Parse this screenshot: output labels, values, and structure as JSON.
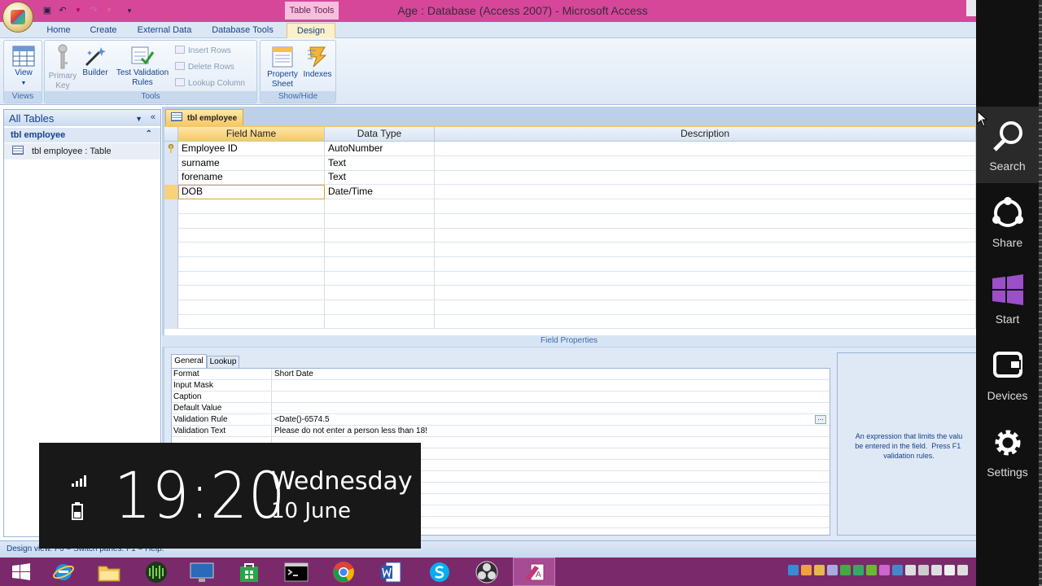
{
  "window": {
    "title": "Age : Database (Access 2007)  -  Microsoft Access",
    "context_tab": "Table Tools"
  },
  "tabs": [
    "Home",
    "Create",
    "External Data",
    "Database Tools",
    "Design"
  ],
  "ribbon": {
    "views": {
      "view": "View",
      "caption": "Views"
    },
    "tools": {
      "primary_key": "Primary Key",
      "builder": "Builder",
      "test_validation_rules": "Test Validation Rules",
      "insert_rows": "Insert Rows",
      "delete_rows": "Delete Rows",
      "lookup_column": "Lookup Column",
      "caption": "Tools"
    },
    "show_hide": {
      "property_sheet": "Property Sheet",
      "indexes": "Indexes",
      "caption": "Show/Hide"
    }
  },
  "nav_pane": {
    "header": "All Tables",
    "group": "tbl employee",
    "item": "tbl employee : Table"
  },
  "document": {
    "tab": "tbl employee",
    "columns": [
      "Field Name",
      "Data Type",
      "Description"
    ],
    "rows": [
      {
        "field": "Employee ID",
        "type": "AutoNumber",
        "primary_key": true
      },
      {
        "field": "surname",
        "type": "Text"
      },
      {
        "field": "forename",
        "type": "Text"
      },
      {
        "field": "DOB",
        "type": "Date/Time",
        "selected": true
      }
    ]
  },
  "field_properties": {
    "label": "Field Properties",
    "tabs": [
      "General",
      "Lookup"
    ],
    "rows": [
      {
        "name": "Format",
        "value": "Short Date"
      },
      {
        "name": "Input Mask",
        "value": ""
      },
      {
        "name": "Caption",
        "value": ""
      },
      {
        "name": "Default Value",
        "value": ""
      },
      {
        "name": "Validation Rule",
        "value": "<Date()-6574.5"
      },
      {
        "name": "Validation Text",
        "value": "Please do not enter a person less than 18!"
      }
    ],
    "help_text": "An expression that limits the valu\nbe entered in the field.  Press F1 \nvalidation rules."
  },
  "status_bar": {
    "text": "Design view.  F6 = Switch panes.  F1 = Help."
  },
  "lock_overlay": {
    "time": "19:20",
    "day": "Wednesday",
    "date": "10 June"
  },
  "charms": [
    "Search",
    "Share",
    "Start",
    "Devices",
    "Settings"
  ]
}
